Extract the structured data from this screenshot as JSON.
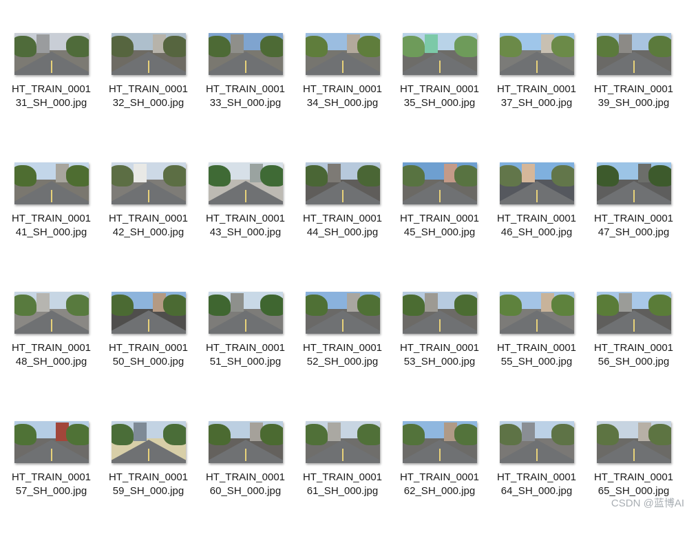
{
  "files": [
    {
      "name": "HT_TRAIN_000131_SH_000.jpg",
      "sky": "#c9ced6",
      "ground": "#7c7a73",
      "veg": "#4f6b3a",
      "bldg": "#9a9c9e"
    },
    {
      "name": "HT_TRAIN_000132_SH_000.jpg",
      "sky": "#aebfcc",
      "ground": "#6e6b63",
      "veg": "#56653f",
      "bldg": "#b7b3aa"
    },
    {
      "name": "HT_TRAIN_000133_SH_000.jpg",
      "sky": "#7fa4cf",
      "ground": "#7a7870",
      "veg": "#4d6a35",
      "bldg": "#8f8f8a"
    },
    {
      "name": "HT_TRAIN_000134_SH_000.jpg",
      "sky": "#9bbde0",
      "ground": "#76756f",
      "veg": "#5f7d3c",
      "bldg": "#b3a99c"
    },
    {
      "name": "HT_TRAIN_000135_SH_000.jpg",
      "sky": "#b9d3e8",
      "ground": "#6d6c68",
      "veg": "#6e9b5a",
      "bldg": "#7cc9a8"
    },
    {
      "name": "HT_TRAIN_000137_SH_000.jpg",
      "sky": "#9fc6ea",
      "ground": "#7b7b78",
      "veg": "#6b8a48",
      "bldg": "#c8c0b2"
    },
    {
      "name": "HT_TRAIN_000139_SH_000.jpg",
      "sky": "#a9c4e0",
      "ground": "#6a6966",
      "veg": "#5b7a3c",
      "bldg": "#8c8a86"
    },
    {
      "name": "HT_TRAIN_000141_SH_000.jpg",
      "sky": "#c3d6e9",
      "ground": "#7a776f",
      "veg": "#4e6d31",
      "bldg": "#a8a59d"
    },
    {
      "name": "HT_TRAIN_000142_SH_000.jpg",
      "sky": "#cdd9e6",
      "ground": "#7e7c77",
      "veg": "#5c6e44",
      "bldg": "#e9e9e6"
    },
    {
      "name": "HT_TRAIN_000143_SH_000.jpg",
      "sky": "#d7e0e8",
      "ground": "#bdbab3",
      "veg": "#3f6a35",
      "bldg": "#9aa3a0"
    },
    {
      "name": "HT_TRAIN_000144_SH_000.jpg",
      "sky": "#b7c9dc",
      "ground": "#5f5d5a",
      "veg": "#4a6635",
      "bldg": "#7d7a75"
    },
    {
      "name": "HT_TRAIN_000145_SH_000.jpg",
      "sky": "#6e9fd0",
      "ground": "#6b6964",
      "veg": "#587341",
      "bldg": "#c49a88"
    },
    {
      "name": "HT_TRAIN_000146_SH_000.jpg",
      "sky": "#7fb0de",
      "ground": "#55585e",
      "veg": "#62764a",
      "bldg": "#d5b79a"
    },
    {
      "name": "HT_TRAIN_000147_SH_000.jpg",
      "sky": "#9cc4e6",
      "ground": "#5e5e5d",
      "veg": "#3d5a2c",
      "bldg": "#6c6e6a"
    },
    {
      "name": "HT_TRAIN_000148_SH_000.jpg",
      "sky": "#c7d6e4",
      "ground": "#8a8884",
      "veg": "#587a3e",
      "bldg": "#b6b5b0"
    },
    {
      "name": "HT_TRAIN_000150_SH_000.jpg",
      "sky": "#8db4dc",
      "ground": "#4f4e4c",
      "veg": "#4b6a33",
      "bldg": "#b49a83"
    },
    {
      "name": "HT_TRAIN_000151_SH_000.jpg",
      "sky": "#c9d9e7",
      "ground": "#7d7c79",
      "veg": "#3f6630",
      "bldg": "#8e908c"
    },
    {
      "name": "HT_TRAIN_000152_SH_000.jpg",
      "sky": "#8ab2dd",
      "ground": "#6a6967",
      "veg": "#4f7035",
      "bldg": "#a9a6a0"
    },
    {
      "name": "HT_TRAIN_000153_SH_000.jpg",
      "sky": "#b7cbe0",
      "ground": "#6c6a66",
      "veg": "#4b6c32",
      "bldg": "#9d9a93"
    },
    {
      "name": "HT_TRAIN_000155_SH_000.jpg",
      "sky": "#a4c4e6",
      "ground": "#7c7b78",
      "veg": "#5e823d",
      "bldg": "#c8b39a"
    },
    {
      "name": "HT_TRAIN_000156_SH_000.jpg",
      "sky": "#a9c8e8",
      "ground": "#5f5e5c",
      "veg": "#5a7c38",
      "bldg": "#9b9c98"
    },
    {
      "name": "HT_TRAIN_000157_SH_000.jpg",
      "sky": "#b5cde4",
      "ground": "#6d6b68",
      "veg": "#4f7236",
      "bldg": "#a2463a"
    },
    {
      "name": "HT_TRAIN_000159_SH_000.jpg",
      "sky": "#c3d3e3",
      "ground": "#d8cfa8",
      "veg": "#4a6d38",
      "bldg": "#7e8a96"
    },
    {
      "name": "HT_TRAIN_000160_SH_000.jpg",
      "sky": "#bccfe1",
      "ground": "#64615d",
      "veg": "#4b6a31",
      "bldg": "#a5a19a"
    },
    {
      "name": "HT_TRAIN_000161_SH_000.jpg",
      "sky": "#c8d5e2",
      "ground": "#6f6e6b",
      "veg": "#507038",
      "bldg": "#aaa8a2"
    },
    {
      "name": "HT_TRAIN_000162_SH_000.jpg",
      "sky": "#8fb7df",
      "ground": "#6c6b68",
      "veg": "#53733b",
      "bldg": "#b09a86"
    },
    {
      "name": "HT_TRAIN_000164_SH_000.jpg",
      "sky": "#bcd1e6",
      "ground": "#7a7875",
      "veg": "#5e7346",
      "bldg": "#8a8e94"
    },
    {
      "name": "HT_TRAIN_000165_SH_000.jpg",
      "sky": "#c7d4e1",
      "ground": "#6b6a66",
      "veg": "#5d7442",
      "bldg": "#b7b0a6"
    }
  ],
  "watermark": "CSDN @蓝博AI"
}
